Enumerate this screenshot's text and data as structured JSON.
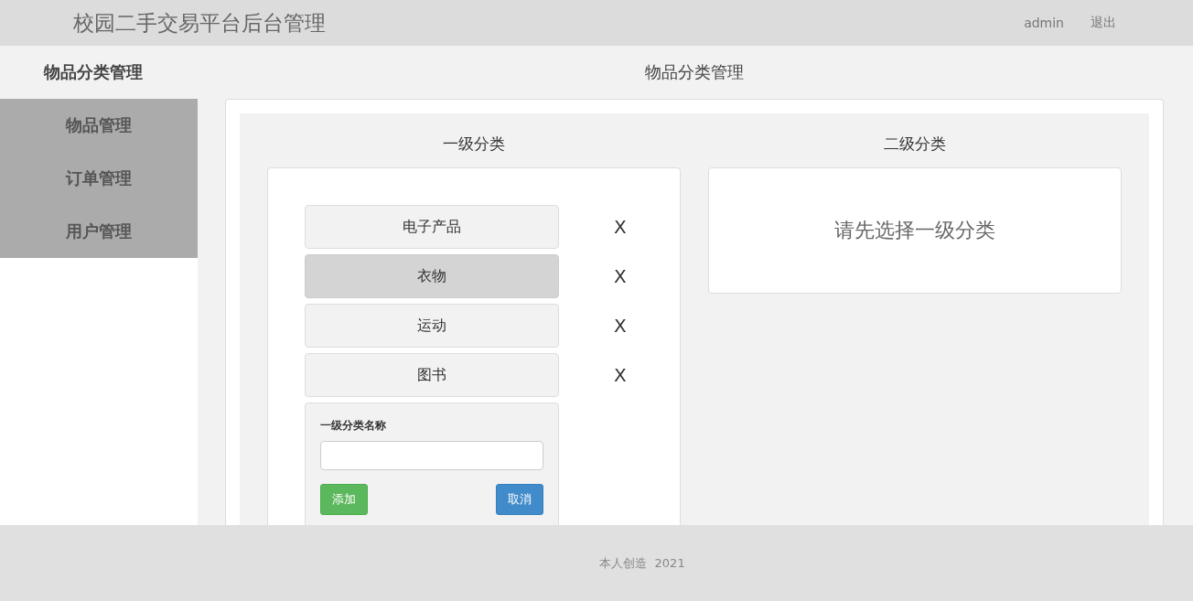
{
  "header": {
    "title": "校园二手交易平台后台管理",
    "user": "admin",
    "logout": "退出"
  },
  "sidebar": {
    "items": [
      {
        "label": "物品分类管理",
        "selected": true
      },
      {
        "label": "物品管理",
        "selected": false
      },
      {
        "label": "订单管理",
        "selected": false
      },
      {
        "label": "用户管理",
        "selected": false
      }
    ]
  },
  "page_title": "物品分类管理",
  "level1": {
    "heading": "一级分类",
    "items": [
      {
        "name": "电子产品",
        "selected": false,
        "delete": "X"
      },
      {
        "name": "衣物",
        "selected": true,
        "delete": "X"
      },
      {
        "name": "运动",
        "selected": false,
        "delete": "X"
      },
      {
        "name": "图书",
        "selected": false,
        "delete": "X"
      }
    ],
    "form": {
      "label": "一级分类名称",
      "add": "添加",
      "cancel": "取消"
    }
  },
  "level2": {
    "heading": "二级分类",
    "empty_message": "请先选择一级分类"
  },
  "footer": "本人创造  2021"
}
